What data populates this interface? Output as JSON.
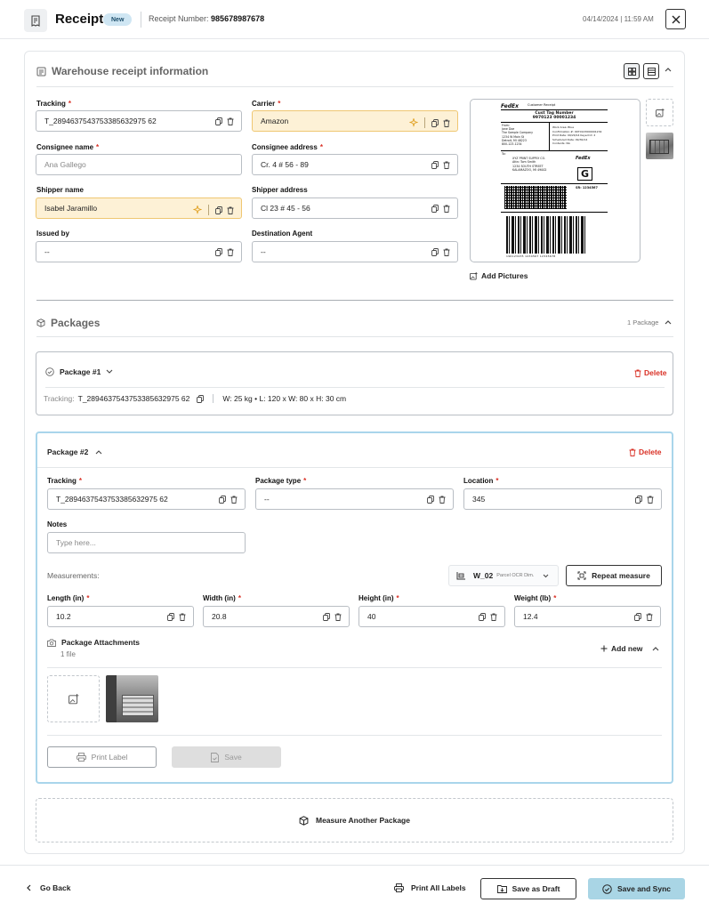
{
  "header": {
    "title": "Receipt",
    "badge": "New",
    "receipt_number_label": "Receipt Number:",
    "receipt_number": "985678987678",
    "datetime": "04/14/2024 | 11:59 AM"
  },
  "warehouse": {
    "title": "Warehouse receipt information",
    "fields": {
      "tracking": {
        "label": "Tracking",
        "required": "*",
        "value": "T_2894637543753385632975 62"
      },
      "carrier": {
        "label": "Carrier",
        "required": "*",
        "value": "Amazon"
      },
      "consignee_name": {
        "label": "Consignee name",
        "required": "*",
        "placeholder": "Ana Gallego"
      },
      "consignee_address": {
        "label": "Consignee address",
        "required": "*",
        "value": "Cr. 4 # 56 - 89"
      },
      "shipper_name": {
        "label": "Shipper name",
        "value": "Isabel Jaramillo"
      },
      "shipper_address": {
        "label": "Shipper address",
        "value": "Cl 23 # 45 - 56"
      },
      "issued_by": {
        "label": "Issued by",
        "value": "--"
      },
      "destination_agent": {
        "label": "Destination Agent",
        "value": "--"
      }
    },
    "add_pictures": "Add Pictures",
    "label_image": {
      "brand": "FedEx",
      "receipt_header": "Customer Receipt",
      "cust_tag_label": "Cust Tag Number",
      "cust_tag_number": "9970123 00001234",
      "from_lines": [
        "From:",
        "Jane Doe",
        "The Sample Company",
        "1234 W Main St",
        "Detroit, MI 48223",
        "800-123-1234"
      ],
      "work_lines": [
        "Work Area: Blue",
        "Confirmation #: 9970123000001234",
        "Print Date: 09/20/14   Keyed Id: 2",
        "Scheduled Date: 09/30/14",
        "Contents: NA"
      ],
      "to_lines": [
        "To:",
        "XYZ PRINT SUPPLY CO.",
        "Attn: Tom Smith",
        "1234 SOUTH STREET",
        "KALAMAZOO, MI 49002"
      ],
      "ground_letter": "G",
      "sr_number": "SR: 1234567",
      "barcode_caption": "196123435   1234567   12345678"
    }
  },
  "packages": {
    "title": "Packages",
    "count": "1 Package",
    "package1": {
      "title": "Package #1",
      "delete": "Delete",
      "tracking_label": "Tracking:",
      "tracking": "T_2894637543753385632975 62",
      "summary": "W: 25 kg • L: 120 x W: 80 x H: 30 cm"
    },
    "package2": {
      "title": "Package #2",
      "delete": "Delete",
      "tracking": {
        "label": "Tracking",
        "required": "*",
        "value": "T_2894637543753385632975 62"
      },
      "package_type": {
        "label": "Package type",
        "required": "*",
        "value": "--"
      },
      "location": {
        "label": "Location",
        "required": "*",
        "value": "345"
      },
      "notes": {
        "label": "Notes",
        "placeholder": "Type here..."
      },
      "measurements_label": "Measurements:",
      "device": {
        "name": "W_02",
        "sub": "Parcel OCR Dim."
      },
      "repeat_measure": "Repeat measure",
      "length": {
        "label": "Length (in)",
        "required": "*",
        "value": "10.2"
      },
      "width": {
        "label": "Width (in)",
        "required": "*",
        "value": "20.8"
      },
      "height": {
        "label": "Height (in)",
        "required": "*",
        "value": "40"
      },
      "weight": {
        "label": "Weight (lb)",
        "required": "*",
        "value": "12.4"
      },
      "attachments": {
        "title": "Package Attachments",
        "count": "1 file",
        "add_new": "Add new"
      },
      "print_label": "Print Label",
      "save": "Save"
    },
    "measure_another": "Measure Another Package"
  },
  "footer": {
    "go_back": "Go Back",
    "print_all": "Print All Labels",
    "save_draft": "Save as Draft",
    "save_sync": "Save and Sync"
  },
  "colors": {
    "highlight_bg": "#fdf1d6",
    "highlight_border": "#efc772",
    "active_border": "#a9d5eb",
    "delete_red": "#d93025",
    "sync_button": "#a9d5e5",
    "badge_bg": "#cfe6f3"
  }
}
